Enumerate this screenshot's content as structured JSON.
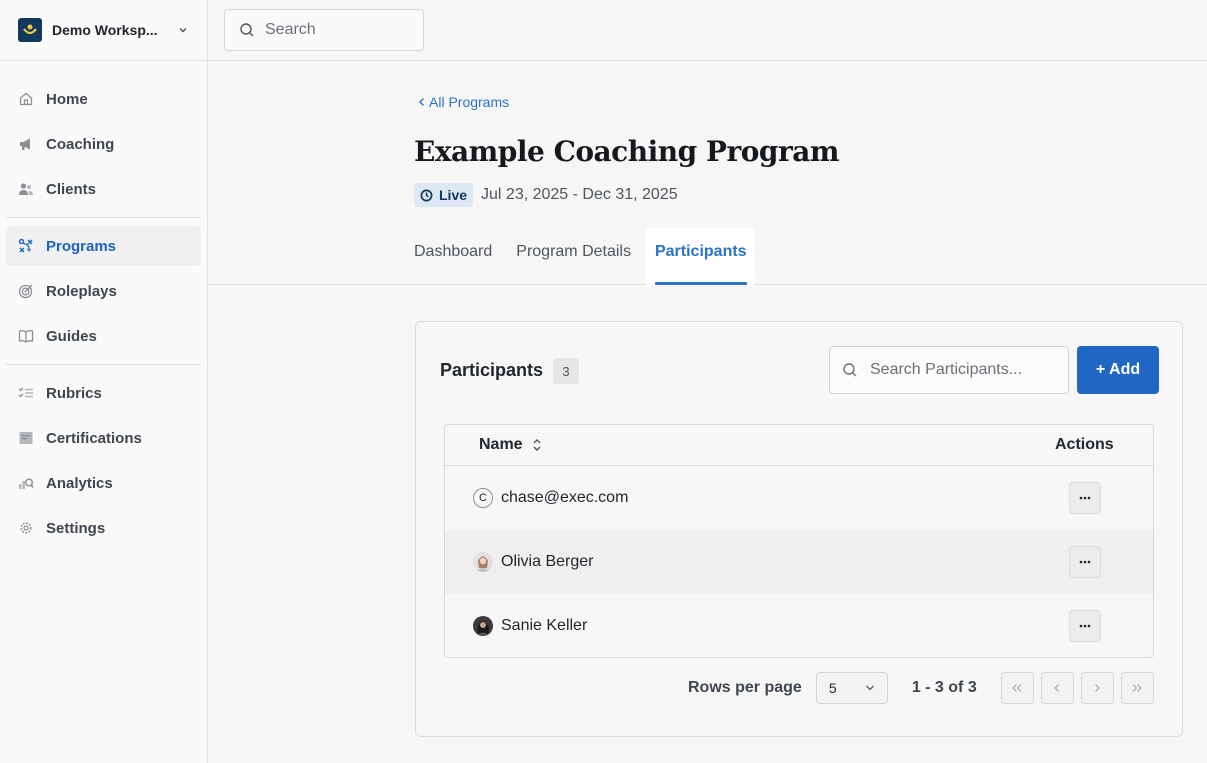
{
  "workspace": {
    "name": "Demo Worksp..."
  },
  "topbar": {
    "search_placeholder": "Search"
  },
  "sidebar": {
    "items": [
      {
        "label": "Home",
        "icon": "home-icon"
      },
      {
        "label": "Coaching",
        "icon": "megaphone-icon"
      },
      {
        "label": "Clients",
        "icon": "users-icon"
      },
      {
        "label": "Programs",
        "icon": "programs-icon",
        "active": true
      },
      {
        "label": "Roleplays",
        "icon": "target-icon"
      },
      {
        "label": "Guides",
        "icon": "book-icon"
      },
      {
        "label": "Rubrics",
        "icon": "checklist-icon"
      },
      {
        "label": "Certifications",
        "icon": "certificate-icon"
      },
      {
        "label": "Analytics",
        "icon": "analytics-icon"
      },
      {
        "label": "Settings",
        "icon": "gear-icon"
      }
    ]
  },
  "header": {
    "back_label": "All Programs",
    "title": "Example Coaching Program",
    "status": "Live",
    "dates": "Jul 23, 2025 - Dec 31, 2025",
    "tabs": [
      {
        "label": "Dashboard"
      },
      {
        "label": "Program Details"
      },
      {
        "label": "Participants",
        "active": true
      }
    ]
  },
  "participants": {
    "title": "Participants",
    "count": "3",
    "search_placeholder": "Search Participants...",
    "add_label": "+ Add",
    "columns": {
      "name": "Name",
      "actions": "Actions"
    },
    "rows": [
      {
        "name": "chase@exec.com",
        "avatar_letter": "C",
        "more_label": "···"
      },
      {
        "name": "Olivia Berger",
        "more_label": "···"
      },
      {
        "name": "Sanie Keller",
        "more_label": "···"
      }
    ],
    "pagination": {
      "rows_per_page_label": "Rows per page",
      "rows_per_page": "5",
      "range": "1 - 3 of 3"
    }
  },
  "colors": {
    "accent": "#1f67c2",
    "link": "#2a73c9",
    "brand": "#14395f"
  }
}
